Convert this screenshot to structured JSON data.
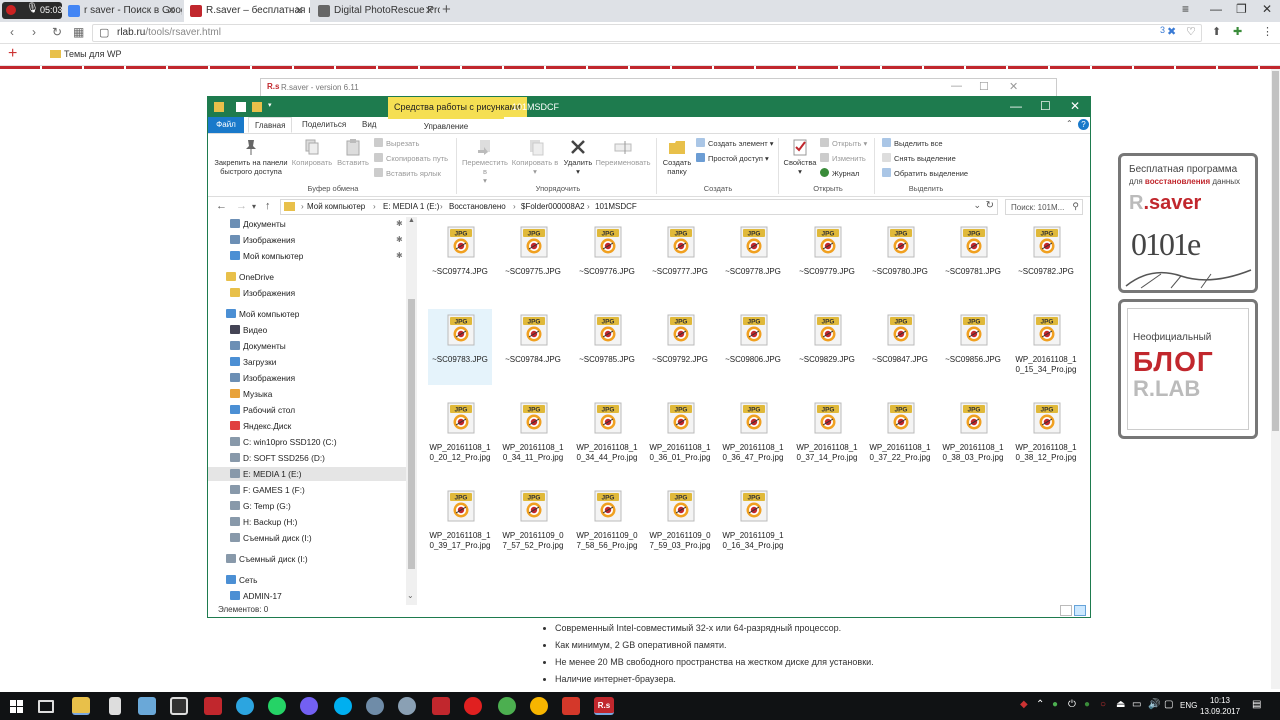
{
  "browser": {
    "recording_time": "05:03",
    "tabs": [
      {
        "title": "r saver - Поиск в Google",
        "active": false,
        "color": "#4285f4"
      },
      {
        "title": "R.saver – бесплатная про...",
        "active": true,
        "color": "#c1272d"
      },
      {
        "title": "Digital PhotoRescue Pro ...",
        "active": false,
        "color": "#666666"
      }
    ],
    "url": "rlab.ru/tools/rsaver.html",
    "url_domain": "rlab.ru",
    "url_path": "/tools/rsaver.html",
    "bookmark": "Темы для WP",
    "badge": "3"
  },
  "page": {
    "requirements": [
      "Современный Intel-совместимый 32-х или 64-разрядный процессор.",
      "Как минимум, 2 GB оперативной памяти.",
      "Не менее 20 MB свободного пространства на жестком диске для установки.",
      "Наличие интернет-браузера."
    ],
    "banner1": {
      "line1": "Бесплатная программа",
      "line2_pre": "для ",
      "line2_bold": "восстановления",
      "line2_post": " данных",
      "logo": ".saver",
      "digits": "0101e"
    },
    "banner2": {
      "line1": "Неофициальный",
      "line2": "БЛОГ",
      "line3": "R.LAB"
    }
  },
  "rsaver_window": {
    "title": "R.saver - version 6.11",
    "icon": "R.s"
  },
  "explorer": {
    "context_tab": "Средства работы с рисунками",
    "folder_name": "101MSDCF",
    "tabs": {
      "file": "Файл",
      "home": "Главная",
      "share": "Поделиться",
      "view": "Вид",
      "manage": "Управление"
    },
    "ribbon": {
      "pin": "Закрепить на панели быстрого доступа",
      "copy": "Копировать",
      "paste": "Вставить",
      "cut": "Вырезать",
      "copy_path": "Скопировать путь",
      "paste_shortcut": "Вставить ярлык",
      "clipboard": "Буфер обмена",
      "move_to": "Переместить в",
      "copy_to": "Копировать в",
      "delete": "Удалить",
      "rename": "Переименовать",
      "organize": "Упорядочить",
      "new_folder": "Создать папку",
      "new_item": "Создать элемент",
      "easy_access": "Простой доступ",
      "new": "Создать",
      "properties": "Свойства",
      "open": "Открыть",
      "edit": "Изменить",
      "history": "Журнал",
      "open_group": "Открыть",
      "select_all": "Выделить все",
      "select_none": "Снять выделение",
      "invert": "Обратить выделение",
      "select": "Выделить"
    },
    "breadcrumb": [
      "Мой компьютер",
      "E: MEDIA 1 (E:)",
      "Восстановлено",
      "$Folder000008A2",
      "101MSDCF"
    ],
    "search_placeholder": "Поиск: 101М...",
    "nav": [
      {
        "label": "Документы",
        "type": "doc",
        "indent": 1,
        "pinned": true
      },
      {
        "label": "Изображения",
        "type": "img",
        "indent": 1,
        "pinned": true
      },
      {
        "label": "Мой компьютер",
        "type": "pc",
        "indent": 1,
        "pinned": true
      },
      {
        "label": "OneDrive",
        "type": "folder",
        "indent": 0
      },
      {
        "label": "Изображения",
        "type": "folder",
        "indent": 1
      },
      {
        "label": "Мой компьютер",
        "type": "pc",
        "indent": 0
      },
      {
        "label": "Видео",
        "type": "vid",
        "indent": 1
      },
      {
        "label": "Документы",
        "type": "doc",
        "indent": 1
      },
      {
        "label": "Загрузки",
        "type": "dl",
        "indent": 1
      },
      {
        "label": "Изображения",
        "type": "img",
        "indent": 1
      },
      {
        "label": "Музыка",
        "type": "music",
        "indent": 1
      },
      {
        "label": "Рабочий стол",
        "type": "desk",
        "indent": 1
      },
      {
        "label": "Яндекс.Диск",
        "type": "yd",
        "indent": 1
      },
      {
        "label": "C: win10pro SSD120 (C:)",
        "type": "drive",
        "indent": 1
      },
      {
        "label": "D: SOFT SSD256 (D:)",
        "type": "drive",
        "indent": 1
      },
      {
        "label": "E: MEDIA 1 (E:)",
        "type": "drive",
        "indent": 1,
        "selected": true
      },
      {
        "label": "F: GAMES 1 (F:)",
        "type": "drive",
        "indent": 1
      },
      {
        "label": "G: Temp (G:)",
        "type": "drive",
        "indent": 1
      },
      {
        "label": "H: Backup (H:)",
        "type": "drive",
        "indent": 1
      },
      {
        "label": "Съемный диск (I:)",
        "type": "drive",
        "indent": 1
      },
      {
        "label": "Съемный диск (I:)",
        "type": "drive",
        "indent": 0
      },
      {
        "label": "Сеть",
        "type": "net",
        "indent": 0
      },
      {
        "label": "ADMIN-17",
        "type": "pc",
        "indent": 1
      }
    ],
    "files": [
      "~SC09774.JPG",
      "~SC09775.JPG",
      "~SC09776.JPG",
      "~SC09777.JPG",
      "~SC09778.JPG",
      "~SC09779.JPG",
      "~SC09780.JPG",
      "~SC09781.JPG",
      "~SC09782.JPG",
      "~SC09783.JPG",
      "~SC09784.JPG",
      "~SC09785.JPG",
      "~SC09792.JPG",
      "~SC09806.JPG",
      "~SC09829.JPG",
      "~SC09847.JPG",
      "~SC09856.JPG",
      "WP_20161108_10_15_34_Pro.jpg",
      "WP_20161108_10_20_12_Pro.jpg",
      "WP_20161108_10_34_11_Pro.jpg",
      "WP_20161108_10_34_44_Pro.jpg",
      "WP_20161108_10_36_01_Pro.jpg",
      "WP_20161108_10_36_47_Pro.jpg",
      "WP_20161108_10_37_14_Pro.jpg",
      "WP_20161108_10_37_22_Pro.jpg",
      "WP_20161108_10_38_03_Pro.jpg",
      "WP_20161108_10_38_12_Pro.jpg",
      "WP_20161108_10_39_17_Pro.jpg",
      "WP_20161109_07_57_52_Pro.jpg",
      "WP_20161109_07_58_56_Pro.jpg",
      "WP_20161109_07_59_03_Pro.jpg",
      "WP_20161109_10_16_34_Pro.jpg"
    ],
    "hovered_file_index": 9,
    "icon_label": "JPG",
    "status": "Элементов: 0"
  },
  "taskbar": {
    "lang": "ENG",
    "time": "10:13",
    "date": "13.09.2017",
    "rs_label": "R.s"
  }
}
